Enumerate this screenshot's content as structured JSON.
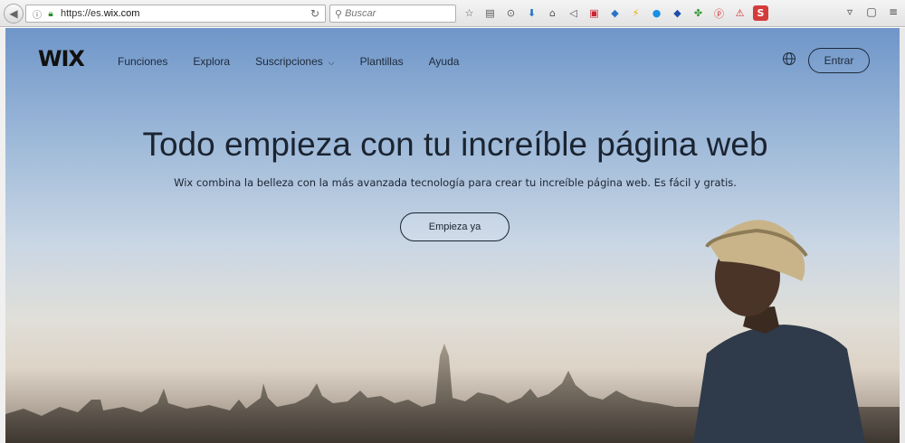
{
  "browser": {
    "url_prefix": "https://es.",
    "url_domain": "wix.com",
    "search_placeholder": "Buscar"
  },
  "site": {
    "logo": "WIX",
    "nav": [
      {
        "label": "Funciones"
      },
      {
        "label": "Explora"
      },
      {
        "label": "Suscripciones"
      },
      {
        "label": "Plantillas"
      },
      {
        "label": "Ayuda"
      }
    ],
    "login_label": "Entrar"
  },
  "hero": {
    "title": "Todo empieza con tu increíble página web",
    "subtitle": "Wix combina la belleza con la más avanzada tecnología para crear tu increíble página web. Es fácil y gratis.",
    "cta_label": "Empieza ya"
  },
  "colors": {
    "text_dark": "#1b2431",
    "sky_top": "#6f96c9",
    "pocket_red": "#d43c3c"
  },
  "icons": {
    "toolbar": [
      "star-icon",
      "reading-list-icon",
      "pocket-icon",
      "download-icon",
      "home-icon",
      "send-icon",
      "screenshot-icon",
      "dropbox-icon",
      "lightning-icon",
      "circle-blue-icon",
      "diamond-icon",
      "extension-icon",
      "pinterest-icon",
      "pdf-icon",
      "s-icon",
      "menu-icon"
    ]
  }
}
